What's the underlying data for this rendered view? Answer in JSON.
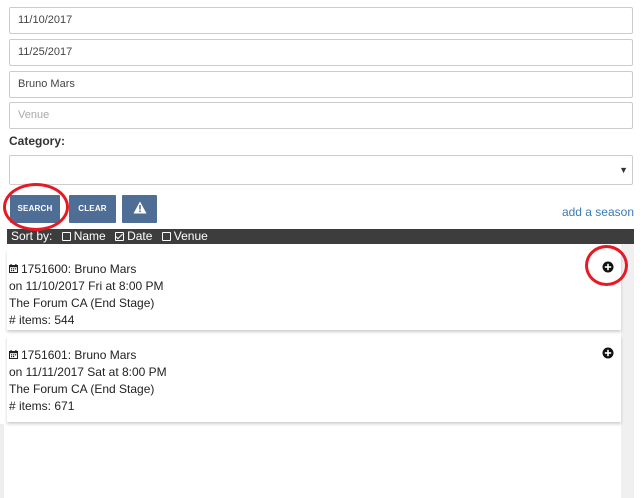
{
  "form": {
    "start_date": "11/10/2017",
    "end_date": "11/25/2017",
    "performer": "Bruno Mars",
    "venue_placeholder": "Venue",
    "category_label": "Category:",
    "category_value": ""
  },
  "buttons": {
    "search": "SEARCH",
    "clear": "CLEAR"
  },
  "links": {
    "add_season": "add a season"
  },
  "sort": {
    "label": "Sort by:",
    "options": [
      {
        "label": "Name",
        "checked": false
      },
      {
        "label": "Date",
        "checked": true
      },
      {
        "label": "Venue",
        "checked": false
      }
    ]
  },
  "events": [
    {
      "id_title": "1751600: Bruno Mars",
      "when": "on 11/10/2017 Fri at 8:00 PM",
      "venue": "The Forum CA (End Stage)",
      "items": "# items: 544"
    },
    {
      "id_title": "1751601: Bruno Mars",
      "when": "on 11/11/2017 Sat at 8:00 PM",
      "venue": "The Forum CA (End Stage)",
      "items": "# items: 671"
    }
  ],
  "colors": {
    "button": "#4e6e96",
    "sortbar": "#3d3d3d",
    "link": "#3a7ab6",
    "annotation": "#e51a24"
  },
  "icons": {
    "warning": "warning-icon",
    "calendar": "calendar-icon",
    "add": "plus-circle-icon"
  }
}
